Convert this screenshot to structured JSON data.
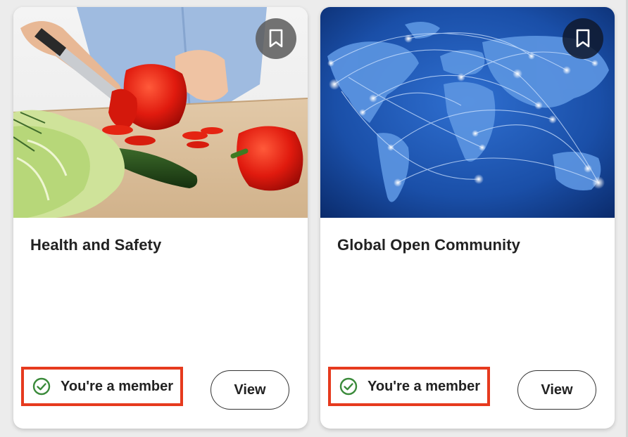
{
  "cards": [
    {
      "title": "Health and Safety",
      "membership_status": "You're a member",
      "action_label": "View",
      "image_subject": "vegetables-cutting-board",
      "icons": {
        "bookmark": "bookmark-icon",
        "status": "check-circle-icon"
      }
    },
    {
      "title": "Global Open Community",
      "membership_status": "You're a member",
      "action_label": "View",
      "image_subject": "world-network-map",
      "icons": {
        "bookmark": "bookmark-icon",
        "status": "check-circle-icon"
      }
    }
  ],
  "colors": {
    "highlight_border": "#e63a1e",
    "check_green": "#3a8a3a",
    "text": "#222222",
    "map_blue": "#1d56b0"
  }
}
